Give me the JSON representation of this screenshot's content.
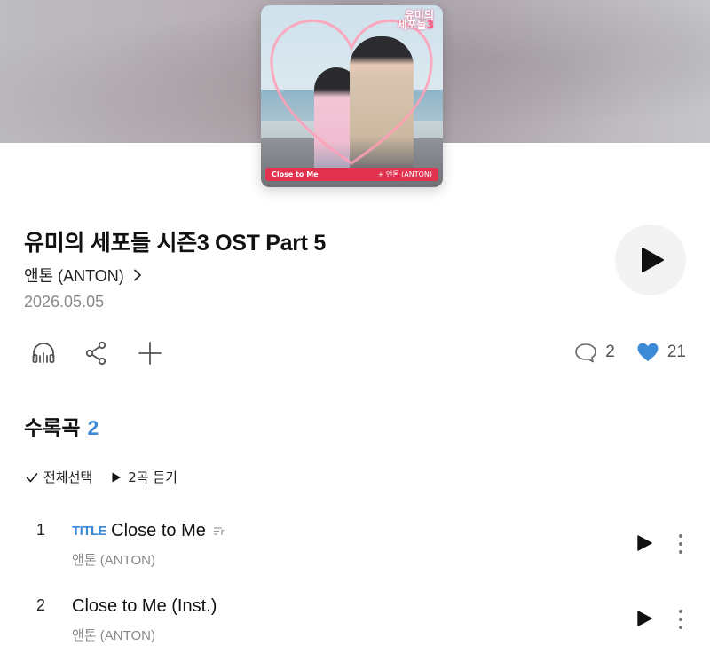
{
  "cover": {
    "logo_line1": "유미의",
    "logo_line2": "세포들",
    "logo_badge": "3",
    "banner_title": "Close to Me",
    "banner_artist": "+ 앤톤 (ANTON)"
  },
  "album": {
    "title": "유미의 세포들 시즌3 OST Part 5",
    "artist": "앤톤 (ANTON)",
    "release_date": "2026.05.05"
  },
  "social": {
    "comment_count": "2",
    "like_count": "21",
    "like_color": "#3d8ad6"
  },
  "tracklist": {
    "heading": "수록곡",
    "count": "2",
    "select_all_label": "전체선택",
    "play_all_label": "2곡 듣기",
    "tracks": [
      {
        "number": "1",
        "badge": "TITLE",
        "title": "Close to Me",
        "artist": "앤톤 (ANTON)"
      },
      {
        "number": "2",
        "badge": "",
        "title": "Close to Me (Inst.)",
        "artist": "앤톤 (ANTON)"
      }
    ]
  },
  "colors": {
    "accent": "#3d8ad6"
  }
}
